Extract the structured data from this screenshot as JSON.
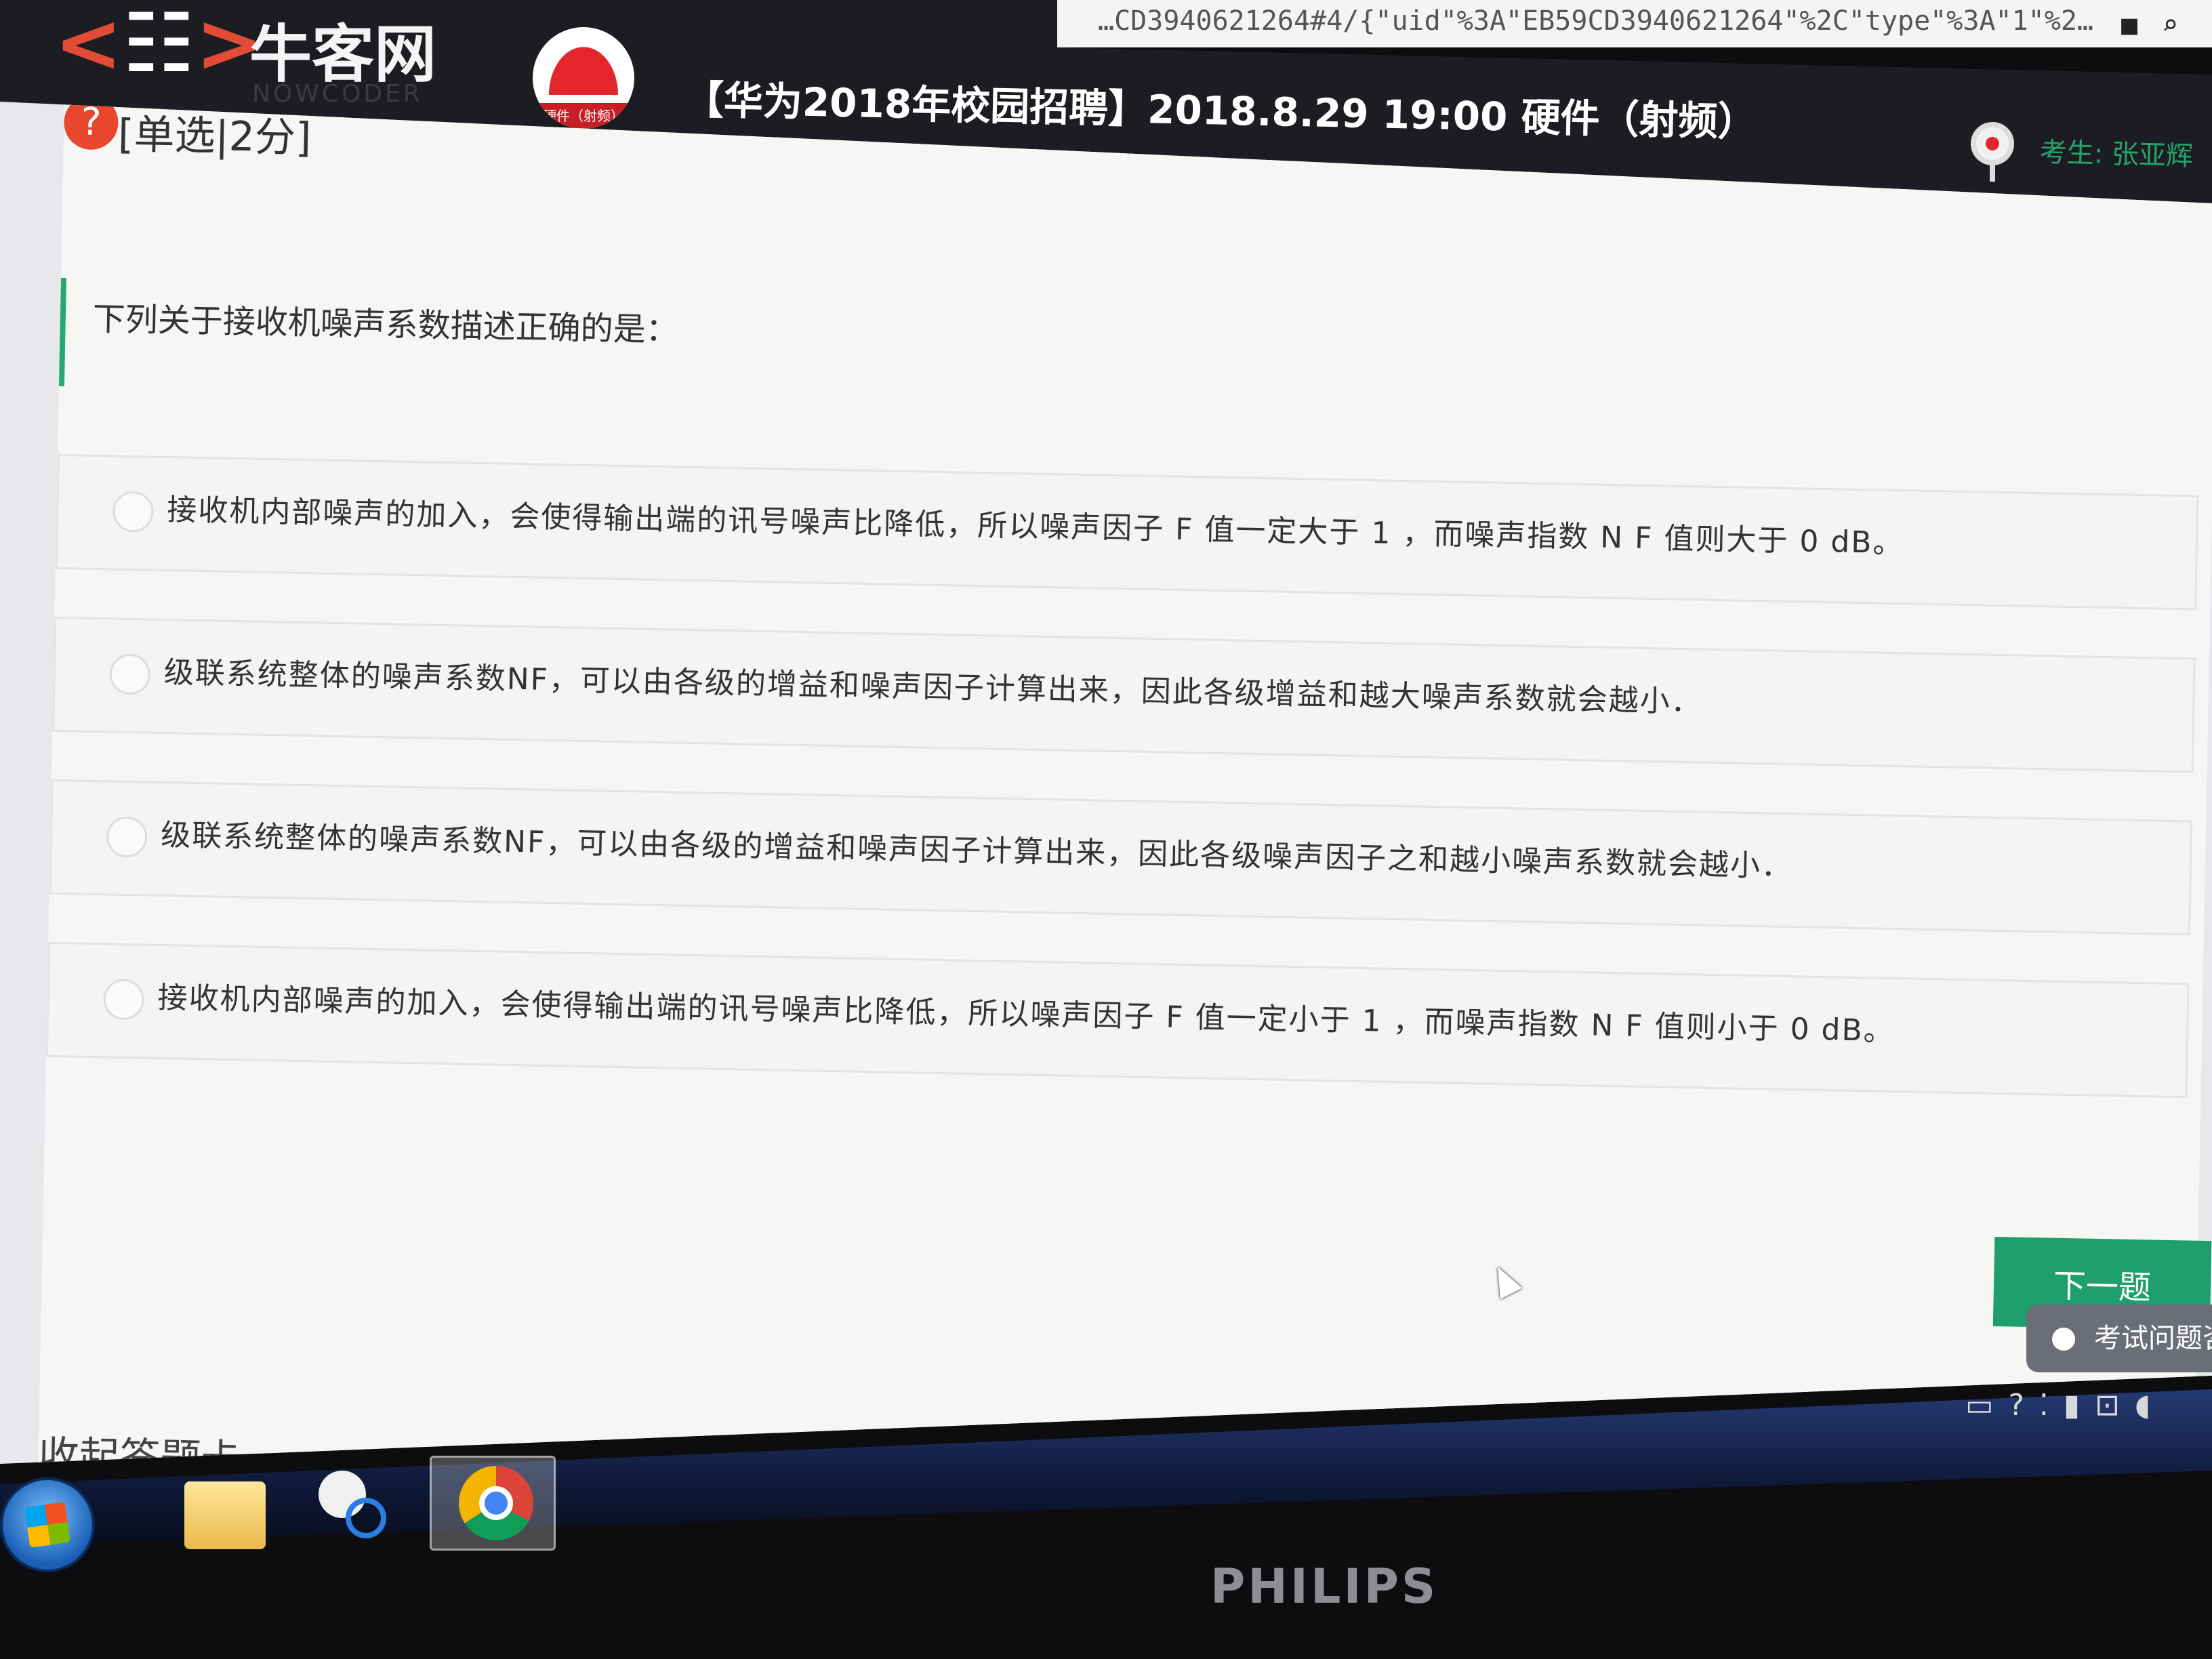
{
  "browser": {
    "url": "…CD3940621264#4/{\"uid\"%3A\"EB59CD3940621264\"%2C\"type\"%3A\"1\"%2…"
  },
  "header": {
    "site_name": "牛客网",
    "site_sub": "NOWCODER",
    "company_logo_text": "硬件（射频）",
    "exam_title": "【华为2018年校园招聘】2018.8.29 19:00 硬件（射频）",
    "candidate": "考生: 张亚辉"
  },
  "question": {
    "type_label": "[单选|2分]",
    "stem": "下列关于接收机噪声系数描述正确的是：",
    "options": [
      "接收机内部噪声的加入，会使得输出端的讯号噪声比降低，所以噪声因子 F 值一定大于 1 ，而噪声指数 N F 值则大于 0 dB。",
      "级联系统整体的噪声系数NF，可以由各级的增益和噪声因子计算出来，因此各级增益和越大噪声系数就会越小．",
      "级联系统整体的噪声系数NF，可以由各级的增益和噪声因子计算出来，因此各级噪声因子之和越小噪声系数就会越小．",
      "接收机内部噪声的加入，会使得输出端的讯号噪声比降低，所以噪声因子 F 值一定小于 1 ，而噪声指数 N F 值则小于 0 dB。"
    ]
  },
  "actions": {
    "next_label": "下一题",
    "collapse_label": "收起答题卡 ⌄",
    "help_label": "考试问题咨"
  },
  "monitor": {
    "brand": "PHILIPS"
  },
  "colors": {
    "accent": "#1f9f6d",
    "header_bg": "#1c1d22",
    "question_icon": "#e8472e"
  }
}
